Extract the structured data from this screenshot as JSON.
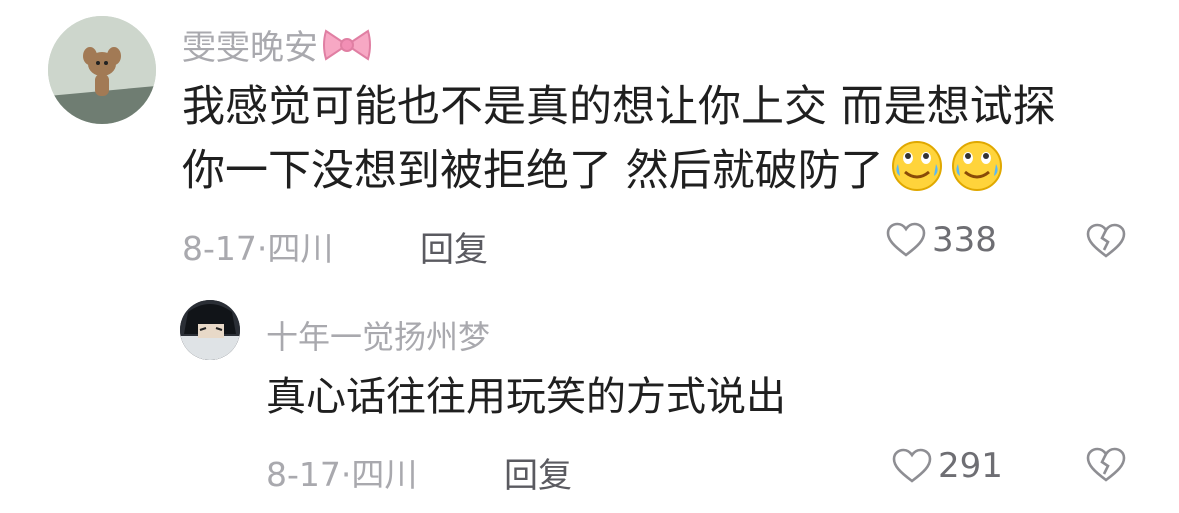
{
  "comments": [
    {
      "username": "雯雯晚安",
      "username_icon": "bow-icon",
      "text_line1": "我感觉可能也不是真的想让你上交 而是想试探",
      "text_line2": "你一下没想到被拒绝了 然后就破防了",
      "emojis": [
        "crying-laugh-emoji",
        "crying-laugh-emoji"
      ],
      "date": "8-17",
      "location": "四川",
      "reply_label": "回复",
      "likes": "338"
    },
    {
      "username": "十年一觉扬州梦",
      "text": "真心话往往用玩笑的方式说出",
      "date": "8-17",
      "location": "四川",
      "reply_label": "回复",
      "likes": "291"
    }
  ],
  "meta_separator": "·",
  "colors": {
    "muted": "#a9a9ae",
    "text": "#1f1f1f",
    "icon": "#8e8e93"
  }
}
